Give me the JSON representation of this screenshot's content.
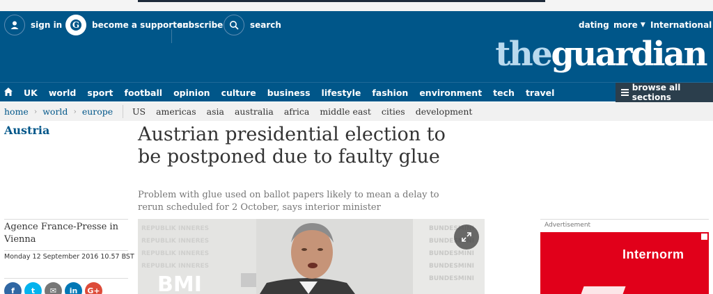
{
  "header": {
    "sign_in": "sign in",
    "become_supporter": "become a supporter",
    "subscribe": "subscribe",
    "search": "search",
    "dating": "dating",
    "more": "more",
    "edition": "International",
    "logo_the": "the",
    "logo_guardian": "guardian"
  },
  "nav": {
    "items": [
      "UK",
      "world",
      "sport",
      "football",
      "opinion",
      "culture",
      "business",
      "lifestyle",
      "fashion",
      "environment",
      "tech",
      "travel"
    ],
    "browse": "browse all sections"
  },
  "subnav": {
    "breadcrumbs": [
      "home",
      "world",
      "europe"
    ],
    "links": [
      "US",
      "americas",
      "asia",
      "australia",
      "africa",
      "middle east",
      "cities",
      "development"
    ]
  },
  "article": {
    "section": "Austria",
    "headline": "Austrian presidential election to be postponed due to faulty glue",
    "standfirst": "Problem with glue used on ballot papers likely to mean a delay to rerun scheduled for 2 October, says interior minister",
    "byline": "Agence France-Presse in Vienna",
    "date": "Monday 12 September 2016 10.57 BST"
  },
  "share": [
    {
      "icon": "facebook-icon",
      "glyph": "f",
      "color": "#3067a3"
    },
    {
      "icon": "twitter-icon",
      "glyph": "t",
      "color": "#03b3ee"
    },
    {
      "icon": "email-icon",
      "glyph": "✉",
      "color": "#767676"
    },
    {
      "icon": "linkedin-icon",
      "glyph": "in",
      "color": "#0077b5"
    },
    {
      "icon": "googleplus-icon",
      "glyph": "G+",
      "color": "#dd4b39"
    }
  ],
  "photo": {
    "backdrop_text": "BMI",
    "wall_text": "BUNDESMINI"
  },
  "advert": {
    "label": "Advertisement",
    "brand": "Internorm"
  },
  "colors": {
    "brand_blue": "#005689",
    "browse_bg": "#2b3e4c",
    "ad_red": "#e1001a"
  }
}
